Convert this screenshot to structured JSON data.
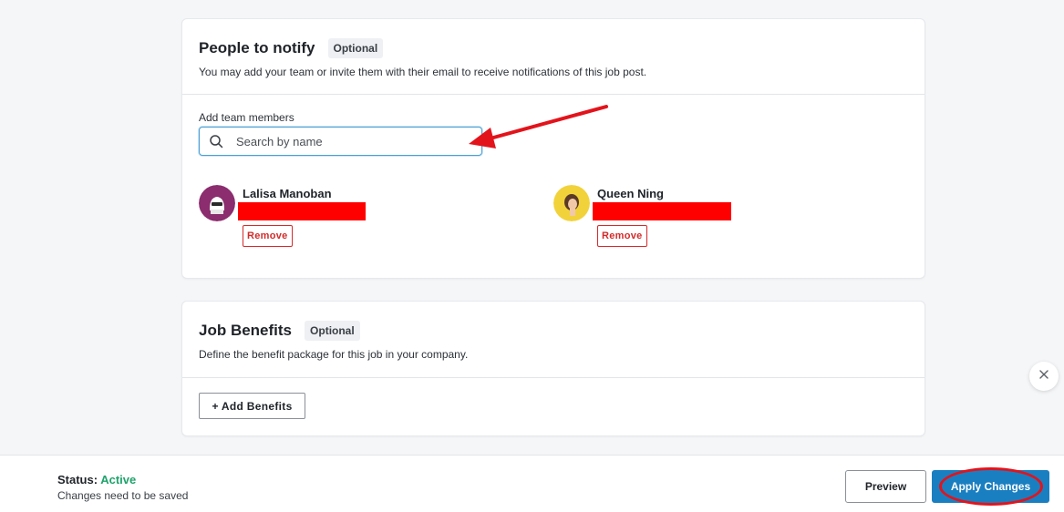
{
  "notify": {
    "title": "People to notify",
    "badge": "Optional",
    "subtitle": "You may add your team or invite them with their email to receive notifications of this job post.",
    "field_label": "Add team members",
    "search_placeholder": "Search by name",
    "members": [
      {
        "name": "Lalisa Manoban",
        "remove_label": "Remove",
        "avatar_color": "#8b2d6e"
      },
      {
        "name": "Queen Ning",
        "remove_label": "Remove",
        "avatar_color": "#f2d23a"
      }
    ]
  },
  "benefits": {
    "title": "Job Benefits",
    "badge": "Optional",
    "subtitle": "Define the benefit package for this job in your company.",
    "add_label": "+ Add Benefits"
  },
  "footer": {
    "status_label": "Status:",
    "status_value": "Active",
    "status_color": "#1fa36b",
    "status_note": "Changes need to be saved",
    "preview_label": "Preview",
    "apply_label": "Apply Changes"
  },
  "colors": {
    "accent": "#1a7fc1",
    "danger": "#d42a2a",
    "annotation": "#e3131b"
  },
  "icons": {
    "search": "search-icon",
    "close": "close-icon"
  }
}
